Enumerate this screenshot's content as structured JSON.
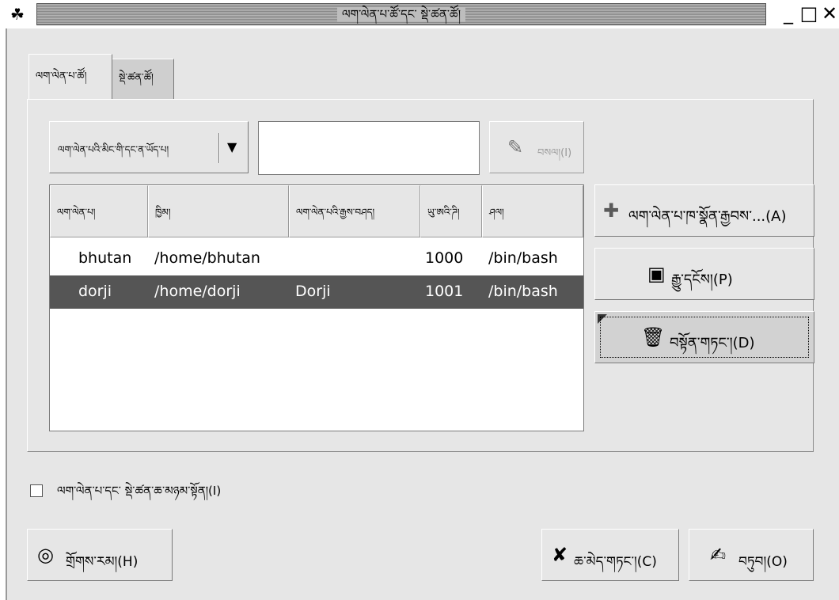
{
  "window": {
    "title": "ལག་ལེན་པ་ཚོ་དང་ སྡེ་ཚན་ཚོ།",
    "menu_icon": "window-menu-icon",
    "minimize_glyph": "_",
    "maximize_glyph": "□",
    "close_glyph": "✕"
  },
  "tabs": [
    {
      "label": "ལག་ལེན་པ་ཚོ།",
      "active": true
    },
    {
      "label": "སྡེ་ཚན་ཚོ།",
      "active": false
    }
  ],
  "filter": {
    "combo_label": "ལག་ལེན་པའི་མིང་གི་དང་ན་ཡོད་པ།",
    "search_value": "",
    "clear_label": "བསལ།(I)",
    "clear_icon": "broom-icon"
  },
  "table": {
    "columns": [
      "ལག་ལེན་པ།",
      "ཁྱིམ།",
      "ལག་ལེན་པའི་རྒྱས་བཤད།",
      "ཡུ་ཨའི་ཌི།",
      "ཤལ།"
    ],
    "rows": [
      [
        "bhutan",
        "/home/bhutan",
        "",
        "1000",
        "/bin/bash"
      ],
      [
        "dorji",
        "/home/dorji",
        "Dorji",
        "1001",
        "/bin/bash"
      ]
    ],
    "selected_row": 1
  },
  "actions": {
    "add": {
      "label": "ལག་ལེན་པ་ཁ་སྣོན་རྒྱབས་...(A)",
      "icon": "plus-icon"
    },
    "properties": {
      "label": "རྒྱུ་དངོས།(P)",
      "icon": "properties-icon"
    },
    "delete": {
      "label": "བསྟོན་གཏང་།(D)",
      "icon": "trash-icon"
    }
  },
  "checkbox": {
    "label": "ལག་ལེན་པ་དང་ སྡེ་ཚན་ཆ་མཉམ་སྟོན།(I)",
    "checked": false
  },
  "bottom": {
    "help": {
      "label": "གྲོགས་རམ།(H)",
      "icon": "lifebuoy-icon"
    },
    "cancel": {
      "label": "ཆ་མེད་གཏང་།(C)",
      "icon": "cancel-icon"
    },
    "ok": {
      "label": "བཏུབ།(O)",
      "icon": "ok-icon"
    }
  }
}
